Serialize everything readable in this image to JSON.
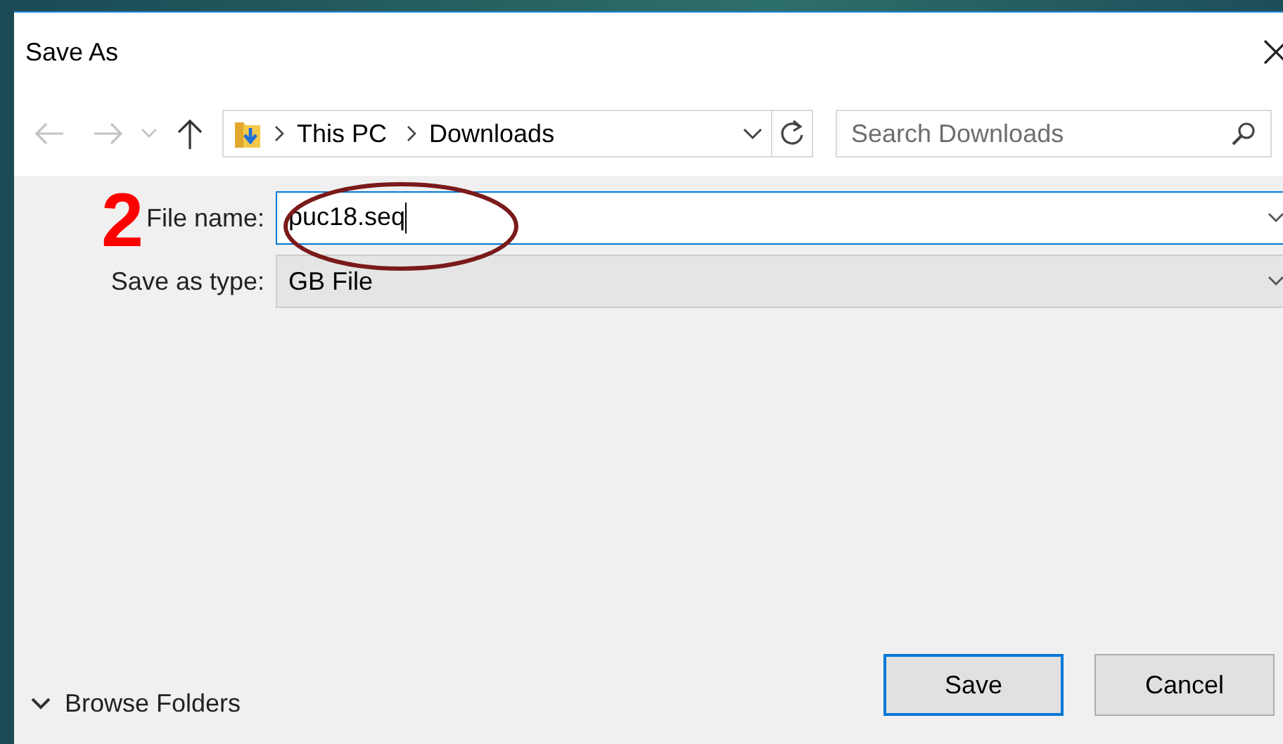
{
  "window": {
    "title": "Save As"
  },
  "navigation": {
    "back": {
      "disabled": true
    },
    "forward": {
      "disabled": true
    },
    "up": {
      "disabled": false
    }
  },
  "breadcrumb": [
    "This PC",
    "Downloads"
  ],
  "search": {
    "placeholder": "Search Downloads"
  },
  "fields": [
    {
      "kind": "input",
      "label": "File name:",
      "value": "puc18.seq",
      "focused": true
    },
    {
      "kind": "select",
      "label": "Save as type:",
      "value": "GB File",
      "focused": false
    }
  ],
  "annotation": {
    "number": "2"
  },
  "browse_folders": {
    "label": "Browse Folders",
    "expanded": false
  },
  "buttons": [
    {
      "label": "Save",
      "default": true
    },
    {
      "label": "Cancel",
      "default": false
    }
  ]
}
